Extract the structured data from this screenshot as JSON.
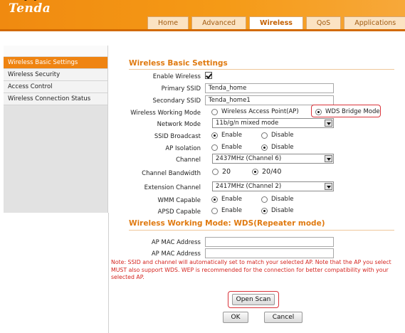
{
  "header": {
    "heading_fragment": "(       )",
    "logo": "Tenda",
    "tabs": [
      "Home",
      "Advanced",
      "Wireless",
      "QoS",
      "Applications"
    ],
    "active_tab": "Wireless"
  },
  "sidebar": {
    "items": [
      {
        "label": "Wireless Basic Settings",
        "active": true
      },
      {
        "label": "Wireless Security",
        "active": false
      },
      {
        "label": "Access Control",
        "active": false
      },
      {
        "label": "Wireless Connection Status",
        "active": false
      }
    ]
  },
  "main": {
    "title": "Wireless Basic Settings",
    "fields": {
      "enable_wireless": {
        "label": "Enable Wireless",
        "checked": true
      },
      "primary_ssid": {
        "label": "Primary SSID",
        "value": "Tenda_home"
      },
      "secondary_ssid": {
        "label": "Secondary SSID",
        "value": "Tenda_home1"
      },
      "working_mode": {
        "label": "Wireless Working Mode",
        "options": [
          "Wireless Access Point(AP)",
          "WDS Bridge Mode"
        ],
        "selected": "WDS Bridge Mode"
      },
      "network_mode": {
        "label": "Network Mode",
        "value": "11b/g/n mixed mode"
      },
      "ssid_broadcast": {
        "label": "SSID Broadcast",
        "options": [
          "Enable",
          "Disable"
        ],
        "selected": "Enable"
      },
      "ap_isolation": {
        "label": "AP Isolation",
        "options": [
          "Enable",
          "Disable"
        ],
        "selected": "Disable"
      },
      "channel": {
        "label": "Channel",
        "value": "2437MHz (Channel 6)"
      },
      "channel_bandwidth": {
        "label": "Channel Bandwidth",
        "options": [
          "20",
          "20/40"
        ],
        "selected": "20/40"
      },
      "extension_channel": {
        "label": "Extension Channel",
        "value": "2417MHz (Channel 2)"
      },
      "wmm_capable": {
        "label": "WMM Capable",
        "options": [
          "Enable",
          "Disable"
        ],
        "selected": "Enable"
      },
      "apsd_capable": {
        "label": "APSD Capable",
        "options": [
          "Enable",
          "Disable"
        ],
        "selected": "Disable"
      }
    },
    "wds_title": "Wireless Working Mode: WDS(Repeater mode)",
    "ap_mac_1": {
      "label": "AP MAC Address",
      "value": ""
    },
    "ap_mac_2": {
      "label": "AP MAC Address",
      "value": ""
    },
    "note": "Note: SSID and channel will automatically set to match your selected AP. Note that the AP you select MUST also support WDS. WEP is recommended for the connection for better compatibility with your selected AP.",
    "open_scan_label": "Open Scan",
    "ok_label": "OK",
    "cancel_label": "Cancel"
  },
  "colors": {
    "brand_orange": "#f08a10",
    "accent_text": "#e07a10",
    "highlight_red": "#d9333a",
    "note_red": "#d4231e"
  }
}
